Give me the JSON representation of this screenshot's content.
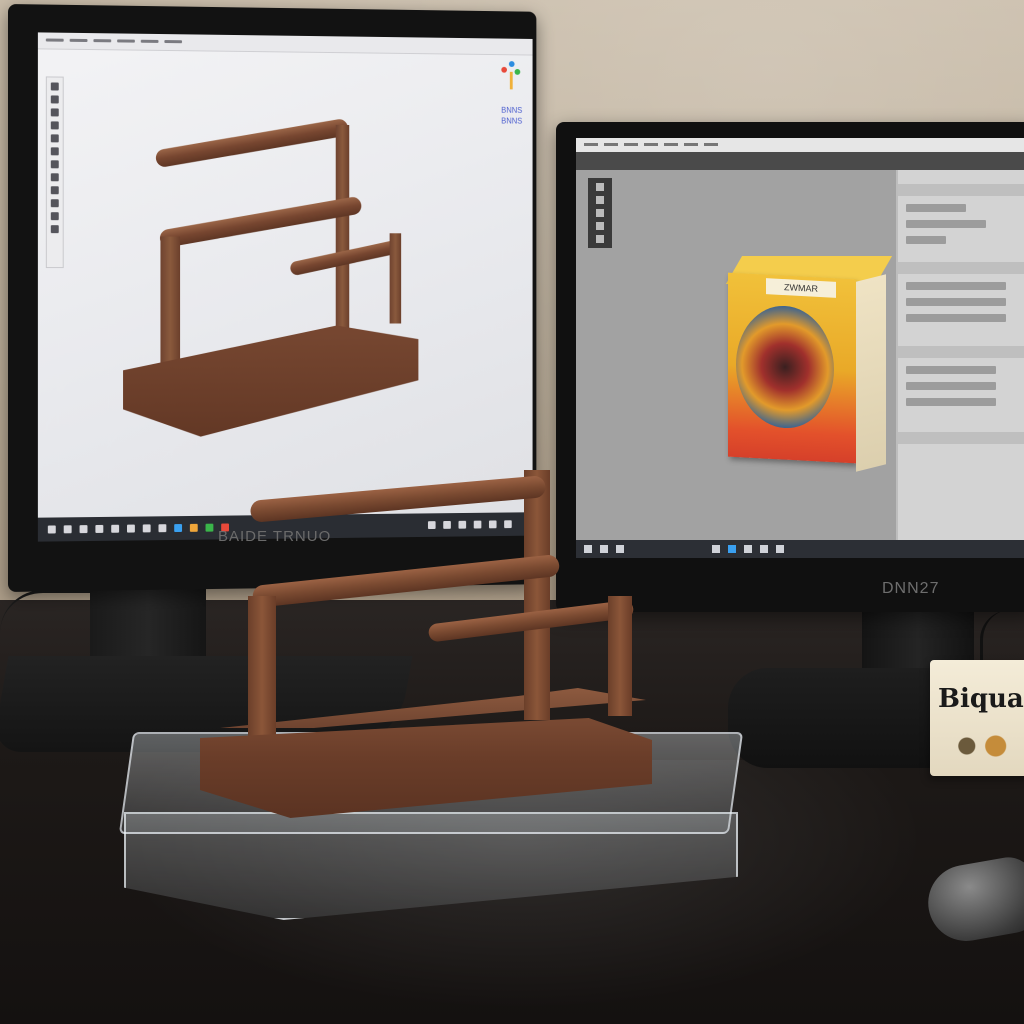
{
  "scene": {
    "left_monitor": {
      "brand_text": "BAIDE TRNUO",
      "screen_logo_text": "BNNS\nBNNS",
      "content": "3d-render-wood-rack"
    },
    "right_monitor": {
      "brand_text": "DNN27",
      "box_label": "ZWMAR",
      "content": "image-editor-with-box"
    },
    "product_box": {
      "text": "Biqua"
    }
  },
  "colors": {
    "wall": "#c9bca9",
    "desk": "#1d1917",
    "wood": "#7a4a33",
    "screen_left": "#eceef1",
    "screen_right": "#9b9b9b"
  }
}
